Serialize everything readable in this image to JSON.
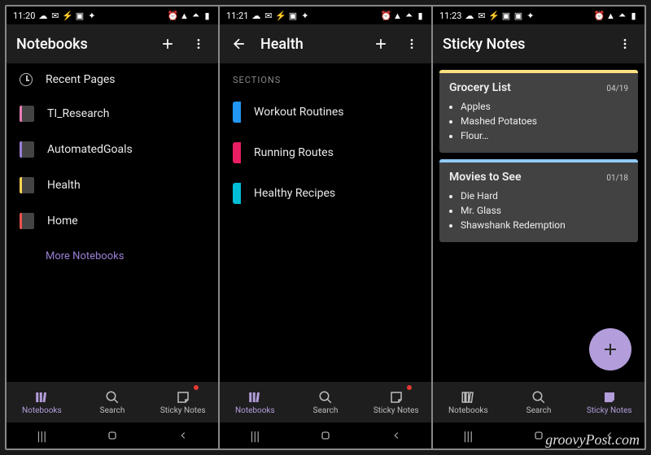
{
  "watermark": "groovyPost.com",
  "screens": [
    {
      "time": "11:20",
      "title": "Notebooks",
      "hasBack": false,
      "hasAdd": true,
      "recent_label": "Recent Pages",
      "notebooks": [
        {
          "label": "TI_Research",
          "color": "#e57eb3"
        },
        {
          "label": "AutomatedGoals",
          "color": "#9a7fd6"
        },
        {
          "label": "Health",
          "color": "#ffd54f"
        },
        {
          "label": "Home",
          "color": "#ef5350"
        }
      ],
      "more_label": "More Notebooks",
      "tabs": {
        "notebooks": "Notebooks",
        "search": "Search",
        "sticky": "Sticky Notes",
        "active": "notebooks",
        "stickyBadge": true
      }
    },
    {
      "time": "11:21",
      "title": "Health",
      "hasBack": true,
      "hasAdd": true,
      "section_header": "SECTIONS",
      "sections": [
        {
          "label": "Workout Routines",
          "color": "#2196f3"
        },
        {
          "label": "Running Routes",
          "color": "#e91e63"
        },
        {
          "label": "Healthy Recipes",
          "color": "#00bcd4"
        }
      ],
      "tabs": {
        "notebooks": "Notebooks",
        "search": "Search",
        "sticky": "Sticky Notes",
        "active": "notebooks",
        "stickyBadge": true
      }
    },
    {
      "time": "11:23",
      "title": "Sticky Notes",
      "hasBack": false,
      "hasAdd": false,
      "notes": [
        {
          "title": "Grocery List",
          "date": "04/19",
          "color": "#ffe082",
          "items": [
            "Apples",
            "Mashed Potatoes",
            "Flour…"
          ]
        },
        {
          "title": "Movies to See",
          "date": "01/18",
          "color": "#90caf9",
          "items": [
            "Die Hard",
            "Mr. Glass",
            "Shawshank Redemption"
          ]
        }
      ],
      "tabs": {
        "notebooks": "Notebooks",
        "search": "Search",
        "sticky": "Sticky Notes",
        "active": "sticky",
        "stickyBadge": false
      }
    }
  ]
}
